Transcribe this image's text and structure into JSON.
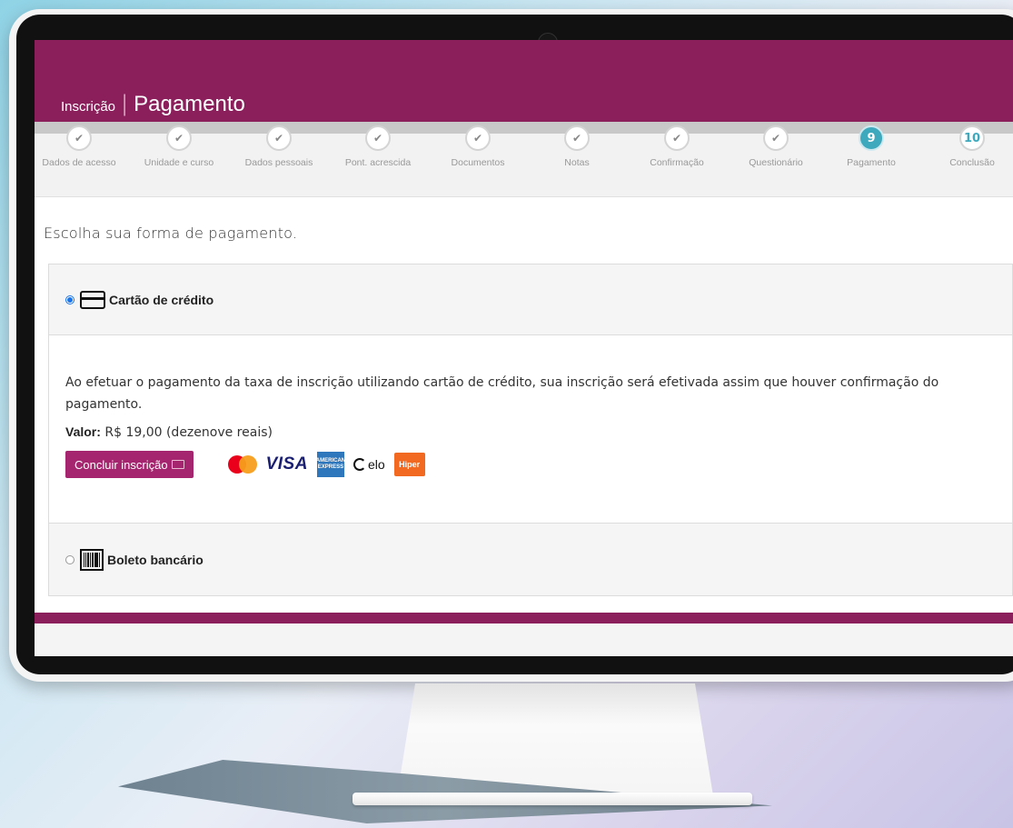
{
  "header": {
    "small_title": "Inscrição",
    "separator": "|",
    "big_title": "Pagamento",
    "color": "#8b1f5c"
  },
  "steps": [
    {
      "label": "Dados de acesso",
      "state": "done",
      "mark": "✔"
    },
    {
      "label": "Unidade e curso",
      "state": "done",
      "mark": "✔"
    },
    {
      "label": "Dados pessoais",
      "state": "done",
      "mark": "✔"
    },
    {
      "label": "Pont. acrescida",
      "state": "done",
      "mark": "✔"
    },
    {
      "label": "Documentos",
      "state": "done",
      "mark": "✔"
    },
    {
      "label": "Notas",
      "state": "done",
      "mark": "✔"
    },
    {
      "label": "Confirmação",
      "state": "done",
      "mark": "✔"
    },
    {
      "label": "Questionário",
      "state": "done",
      "mark": "✔"
    },
    {
      "label": "Pagamento",
      "state": "active",
      "mark": "9"
    },
    {
      "label": "Conclusão",
      "state": "future",
      "mark": "10"
    }
  ],
  "prompt": "Escolha sua forma de pagamento.",
  "payment": {
    "credit": {
      "label": "Cartão de crédito",
      "selected": true,
      "info": "Ao efetuar o pagamento da taxa de inscrição utilizando cartão de crédito, sua inscrição será efetivada assim que houver confirmação do pagamento.",
      "valor_label": "Valor:",
      "valor_text": "R$ 19,00 (dezenove reais)",
      "button_label": "Concluir inscrição",
      "brands": {
        "visa": "VISA",
        "amex": "AMERICAN EXPRESS",
        "elo": "elo",
        "hiper": "Hiper"
      }
    },
    "boleto": {
      "label": "Boleto bancário",
      "selected": false
    },
    "accent": "#a5256e",
    "active_step_color": "#3ea9bd"
  }
}
